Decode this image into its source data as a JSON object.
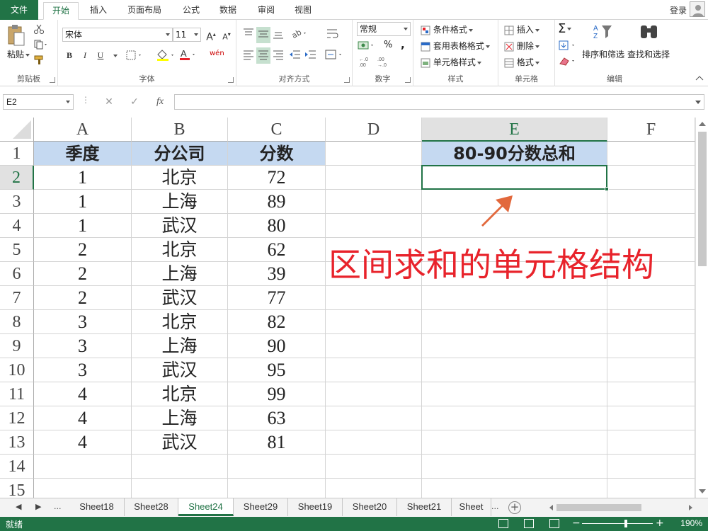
{
  "ribbon_tabs": {
    "file": "文件",
    "items": [
      "开始",
      "插入",
      "页面布局",
      "公式",
      "数据",
      "审阅",
      "视图"
    ],
    "active": "开始",
    "login": "登录"
  },
  "ribbon": {
    "clipboard": {
      "paste": "粘贴",
      "label": "剪贴板"
    },
    "font": {
      "name": "宋体",
      "size": "11",
      "bold": "B",
      "italic": "I",
      "underline": "U",
      "font_color_glyph": "A",
      "wen": "wén",
      "label": "字体"
    },
    "alignment": {
      "label": "对齐方式"
    },
    "number": {
      "format": "常规",
      "percent": "%",
      "comma": ",",
      "label": "数字"
    },
    "styles": {
      "conditional": "条件格式",
      "table": "套用表格格式",
      "cell_style": "单元格样式",
      "label": "样式"
    },
    "cells": {
      "insert": "插入",
      "delete": "删除",
      "format": "格式",
      "label": "单元格"
    },
    "editing": {
      "sort": "排序和筛选",
      "find": "查找和选择",
      "sigma": "Σ",
      "label": "编辑"
    }
  },
  "formula_bar": {
    "name_box": "E2",
    "cancel": "✕",
    "enter": "✓",
    "fx": "fx",
    "value": ""
  },
  "columns": [
    "A",
    "B",
    "C",
    "D",
    "E",
    "F"
  ],
  "selected_column": "E",
  "rows": [
    "1",
    "2",
    "3",
    "4",
    "5",
    "6",
    "7",
    "8",
    "9",
    "10",
    "11",
    "12",
    "13",
    "14",
    "15"
  ],
  "selected_row": "2",
  "table": {
    "headers": [
      "季度",
      "分公司",
      "分数"
    ],
    "data": [
      [
        "1",
        "北京",
        "72"
      ],
      [
        "1",
        "上海",
        "89"
      ],
      [
        "1",
        "武汉",
        "80"
      ],
      [
        "2",
        "北京",
        "62"
      ],
      [
        "2",
        "上海",
        "39"
      ],
      [
        "2",
        "武汉",
        "77"
      ],
      [
        "3",
        "北京",
        "82"
      ],
      [
        "3",
        "上海",
        "90"
      ],
      [
        "3",
        "武汉",
        "95"
      ],
      [
        "4",
        "北京",
        "99"
      ],
      [
        "4",
        "上海",
        "63"
      ],
      [
        "4",
        "武汉",
        "81"
      ]
    ],
    "e1_header": "80-90分数总和"
  },
  "annotation": "区间求和的单元格结构",
  "colors": {
    "excel_green": "#217346",
    "header_fill": "#c5d9f1",
    "annotation_red": "#e8232b",
    "arrow_orange": "#e2683c"
  },
  "sheet_tabs": [
    "Sheet18",
    "Sheet28",
    "Sheet24",
    "Sheet29",
    "Sheet19",
    "Sheet20",
    "Sheet21",
    "Sheet"
  ],
  "active_sheet": "Sheet24",
  "sheet_nav": {
    "prev": "◀",
    "next": "▶",
    "more": "...",
    "more_right": "..."
  },
  "status": {
    "ready": "就绪",
    "zoom_minus": "−",
    "zoom_plus": "+",
    "zoom": "190%"
  }
}
